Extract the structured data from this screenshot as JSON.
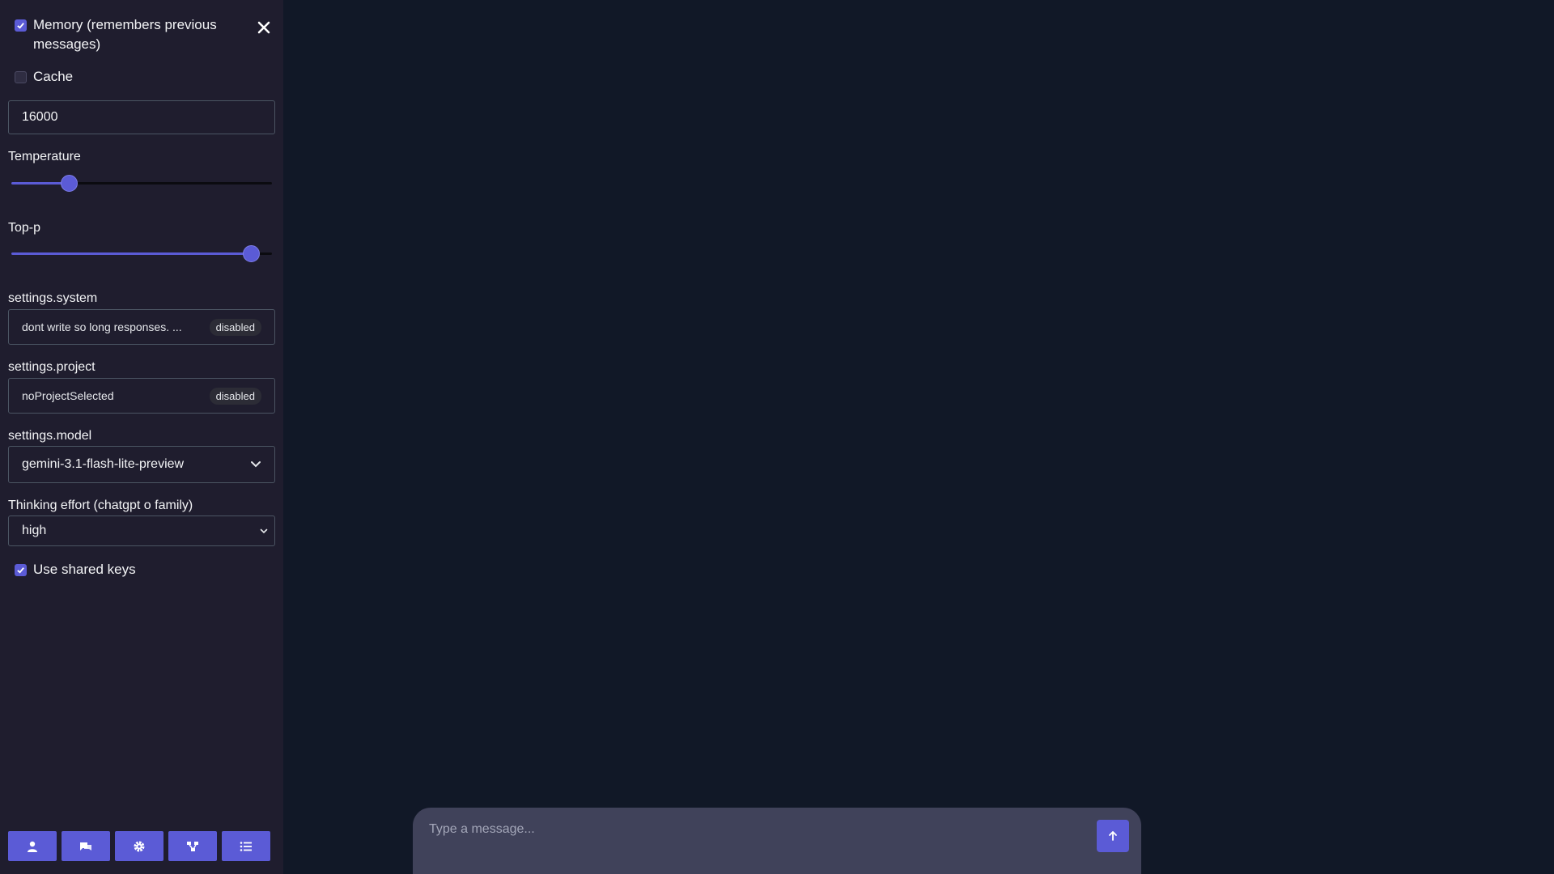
{
  "sidebar": {
    "memory": {
      "label": "Memory (remembers previous messages)",
      "checked": true
    },
    "cache": {
      "label": "Cache",
      "checked": false
    },
    "max_tokens_value": "16000",
    "temperature": {
      "label": "Temperature",
      "value_fraction": 0.22
    },
    "top_p": {
      "label": "Top-p",
      "value_fraction": 0.92
    },
    "system": {
      "label": "settings.system",
      "value": "dont write so long responses. ...",
      "badge": "disabled"
    },
    "project": {
      "label": "settings.project",
      "value": "noProjectSelected",
      "badge": "disabled"
    },
    "model": {
      "label": "settings.model",
      "value": "gemini-3.1-flash-lite-preview"
    },
    "thinking": {
      "label": "Thinking effort (chatgpt o family)",
      "value": "high"
    },
    "shared_keys": {
      "label": "Use shared keys",
      "checked": true
    },
    "nav": [
      {
        "icon": "user-icon"
      },
      {
        "icon": "chat-history-icon"
      },
      {
        "icon": "gear-icon"
      },
      {
        "icon": "share-nodes-icon"
      },
      {
        "icon": "list-icon"
      }
    ]
  },
  "composer": {
    "placeholder": "Type a message..."
  },
  "colors": {
    "accent": "#5b5bd6",
    "sidebar_bg": "#1f1d2e",
    "main_bg": "#111827"
  }
}
